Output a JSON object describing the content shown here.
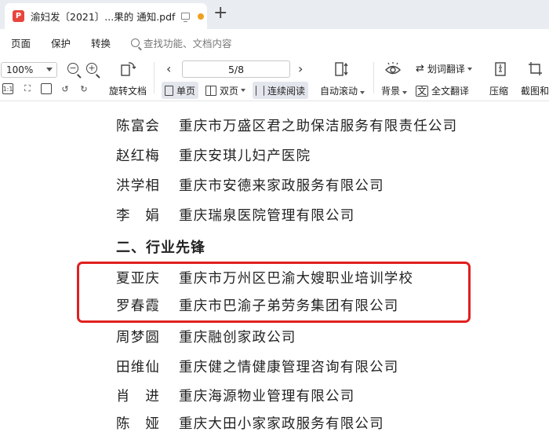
{
  "tab": {
    "badge": "P",
    "title": "渝妇发〔2021〕...果的 通知.pdf",
    "add_label": "+"
  },
  "menu": {
    "items": [
      "页面",
      "保护",
      "转换"
    ],
    "search_placeholder": "查找功能、文档内容"
  },
  "toolbar": {
    "zoom": "100%",
    "page_indicator": "5/8",
    "rotate_label": "旋转文档",
    "single_label": "单页",
    "double_label": "双页",
    "continuous_label": "连续阅读",
    "autoscroll_label": "自动滚动",
    "word_translate_label": "划词翻译",
    "background_label": "背景",
    "full_translate_label": "全文翻译",
    "compress_label": "压缩",
    "screenshot_label": "截图和"
  },
  "document": {
    "rows_top": [
      {
        "name": "陈富会",
        "org": "重庆市万盛区君之助保洁服务有限责任公司"
      },
      {
        "name": "赵红梅",
        "org": "重庆安琪儿妇产医院"
      },
      {
        "name": "洪学相",
        "org": "重庆市安德来家政服务有限公司"
      },
      {
        "name": "李　娟",
        "org": "重庆瑞泉医院管理有限公司"
      }
    ],
    "section_title": "二、行业先锋",
    "rows_bottom": [
      {
        "name": "夏亚庆",
        "org": "重庆市万州区巴渝大嫂职业培训学校"
      },
      {
        "name": "罗春霞",
        "org": "重庆市巴渝子弟劳务集团有限公司"
      },
      {
        "name": "周梦圆",
        "org": "重庆融创家政公司"
      },
      {
        "name": "田维仙",
        "org": "重庆健之情健康管理咨询有限公司"
      },
      {
        "name": "肖　进",
        "org": "重庆海源物业管理有限公司"
      },
      {
        "name": "陈　娅",
        "org": "重庆大田小家家政服务有限公司"
      }
    ]
  },
  "colors": {
    "highlight": "#e0201f",
    "pdf_badge": "#e8453c",
    "unsaved_dot": "#f0a020"
  }
}
